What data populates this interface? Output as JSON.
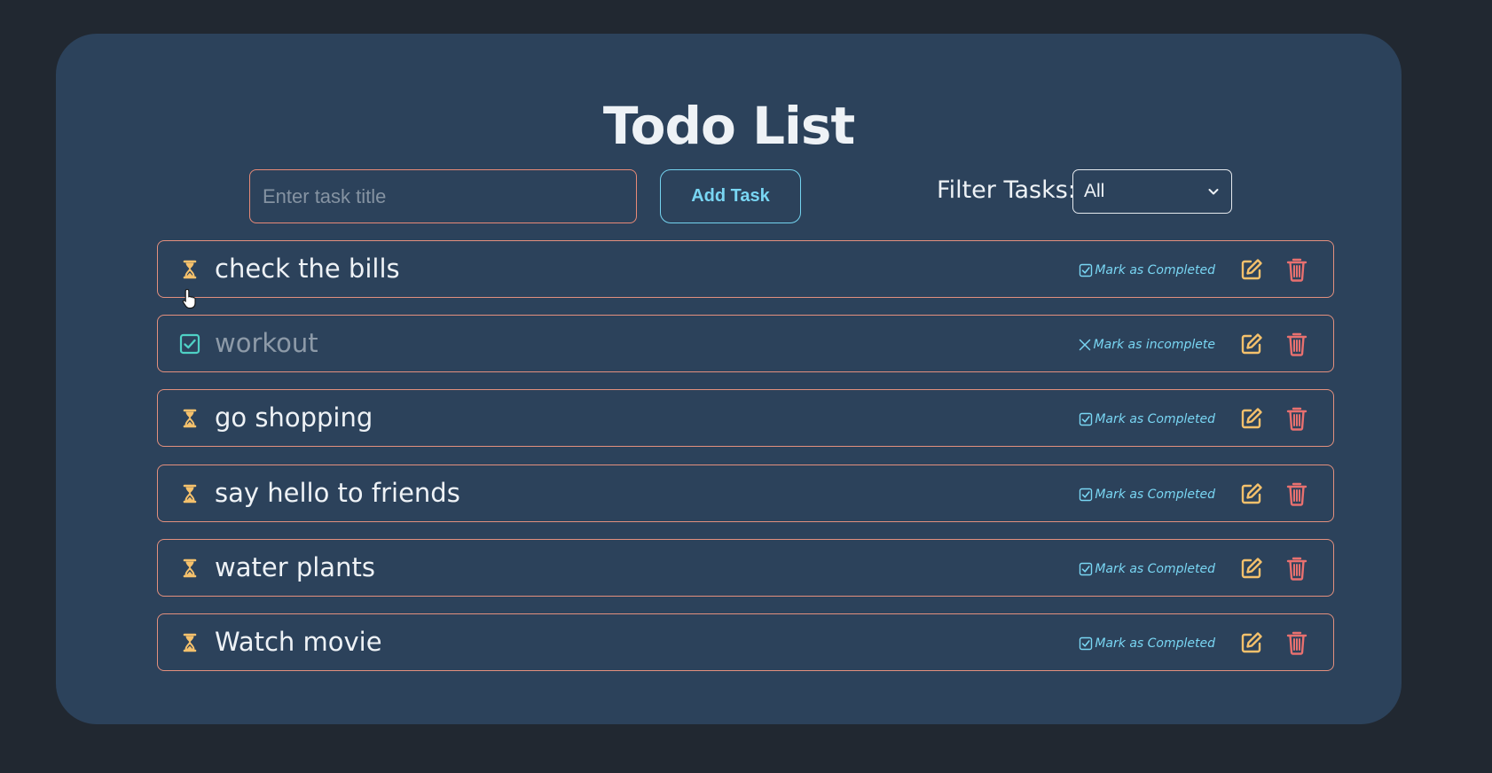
{
  "app": {
    "title": "Todo List"
  },
  "form": {
    "input_value": "",
    "input_placeholder": "Enter task title",
    "add_button_label": "Add Task",
    "filter_label": "Filter Tasks:",
    "filter_selected": "All"
  },
  "tasks": [
    {
      "title": "check the bills",
      "completed": false,
      "status_icon": "hourglass-icon",
      "toggle_label": "Mark as Completed",
      "toggle_icon": "check-square-icon"
    },
    {
      "title": "workout",
      "completed": true,
      "status_icon": "check-square-icon",
      "toggle_label": "Mark as incomplete",
      "toggle_icon": "x-icon"
    },
    {
      "title": "go shopping",
      "completed": false,
      "status_icon": "hourglass-icon",
      "toggle_label": "Mark as Completed",
      "toggle_icon": "check-square-icon"
    },
    {
      "title": "say hello to friends",
      "completed": false,
      "status_icon": "hourglass-icon",
      "toggle_label": "Mark as Completed",
      "toggle_icon": "check-square-icon"
    },
    {
      "title": "water plants",
      "completed": false,
      "status_icon": "hourglass-icon",
      "toggle_label": "Mark as Completed",
      "toggle_icon": "check-square-icon"
    },
    {
      "title": "Watch movie",
      "completed": false,
      "status_icon": "hourglass-icon",
      "toggle_label": "Mark as Completed",
      "toggle_icon": "check-square-icon"
    }
  ],
  "icons": {
    "edit": "edit-icon",
    "delete": "trash-icon",
    "pending": "hourglass-icon",
    "done": "check-square-icon"
  },
  "colors": {
    "page_background": "#212831",
    "card_background": "#2c425b",
    "accent_cyan": "#79d6f3",
    "border_salmon": "#e3907e",
    "pending_icon": "#f5c16c",
    "edit_icon": "#f5c16c",
    "delete_icon": "#e8706f",
    "done_icon": "#4fd1c5"
  }
}
